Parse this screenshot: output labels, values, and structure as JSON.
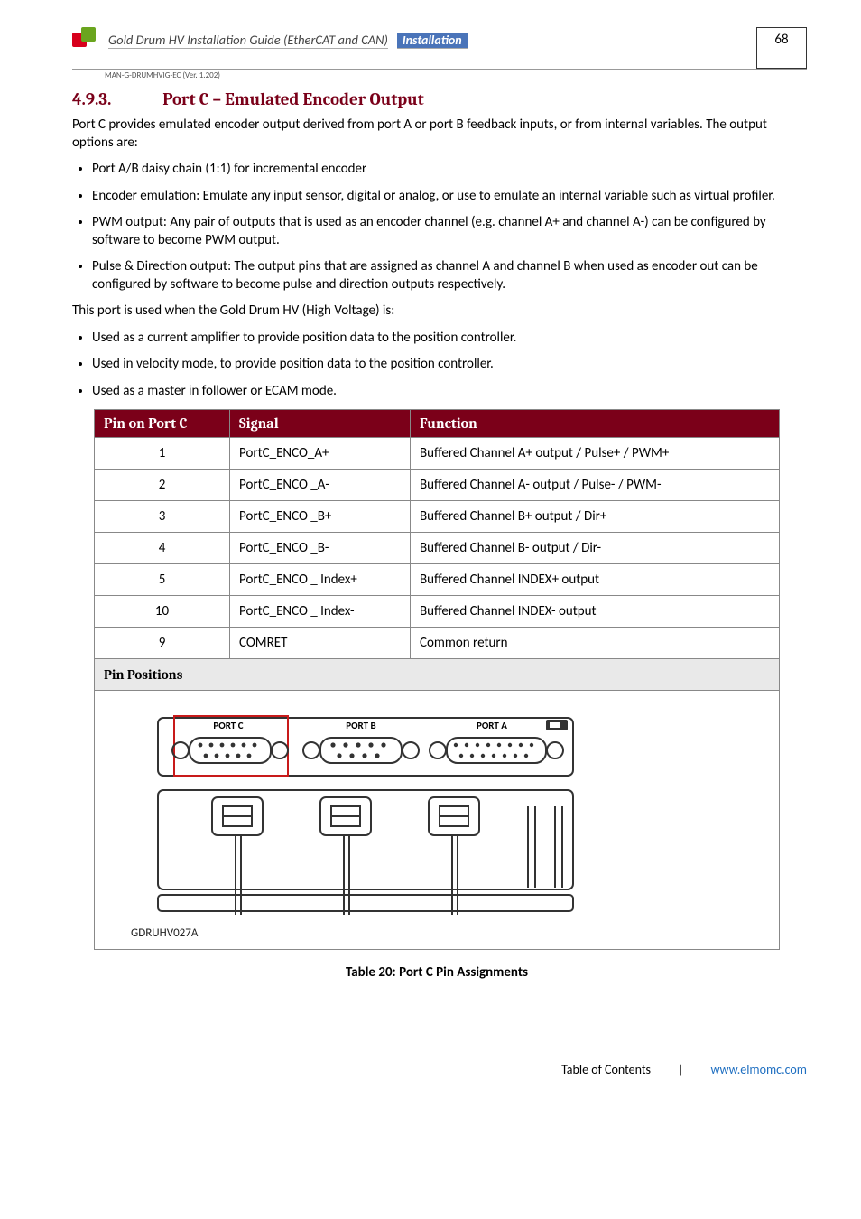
{
  "header": {
    "guide_title": "Gold Drum HV Installation Guide (EtherCAT and CAN)",
    "badge": "Installation",
    "page_number": "68",
    "manual_id": "MAN-G-DRUMHVIG-EC (Ver. 1.202)"
  },
  "section": {
    "number": "4.9.3.",
    "title": "Port C – Emulated Encoder Output",
    "intro": "Port C provides emulated encoder output derived from port A or port B feedback inputs, or from internal variables. The output options are:",
    "bullets1": [
      "Port A/B daisy chain (1:1) for incremental encoder",
      "Encoder emulation: Emulate any input sensor, digital or analog, or use to emulate an internal variable such as virtual profiler.",
      "PWM output: Any pair of outputs that is used as an encoder channel (e.g. channel A+ and channel A-) can be configured by software to become PWM output.",
      "Pulse & Direction output: The output pins that are assigned as channel A and channel B when used as encoder out can be configured by software to become pulse and direction outputs respectively."
    ],
    "used_when": "This port is used when the Gold Drum HV (High Voltage) is:",
    "bullets2": [
      "Used as a current amplifier to provide position data to the position controller.",
      "Used in velocity mode, to provide position data to the position controller.",
      "Used as a master in follower or ECAM mode."
    ]
  },
  "table": {
    "headers": {
      "pin": "Pin on Port C",
      "signal": "Signal",
      "function": "Function"
    },
    "rows": [
      {
        "pin": "1",
        "signal": "PortC_ENCO_A+",
        "function": "Buffered Channel A+ output / Pulse+ / PWM+"
      },
      {
        "pin": "2",
        "signal": "PortC_ENCO _A-",
        "function": "Buffered Channel A- output / Pulse- / PWM-"
      },
      {
        "pin": "3",
        "signal": "PortC_ENCO _B+",
        "function": "Buffered Channel B+ output / Dir+"
      },
      {
        "pin": "4",
        "signal": "PortC_ENCO _B-",
        "function": "Buffered Channel B- output / Dir-"
      },
      {
        "pin": "5",
        "signal": "PortC_ENCO _ Index+",
        "function": "Buffered Channel INDEX+ output"
      },
      {
        "pin": "10",
        "signal": "PortC_ENCO _ Index-",
        "function": "Buffered Channel INDEX- output"
      },
      {
        "pin": "9",
        "signal": "COMRET",
        "function": "Common return"
      }
    ],
    "pin_positions_label": "Pin Positions",
    "diagram": {
      "port_c": "PORT C",
      "port_b": "PORT B",
      "port_a": "PORT A",
      "ref": "GDRUHV027A"
    },
    "caption": "Table 20: Port C Pin Assignments"
  },
  "footer": {
    "toc": "Table of Contents",
    "link": "www.elmomc.com"
  }
}
